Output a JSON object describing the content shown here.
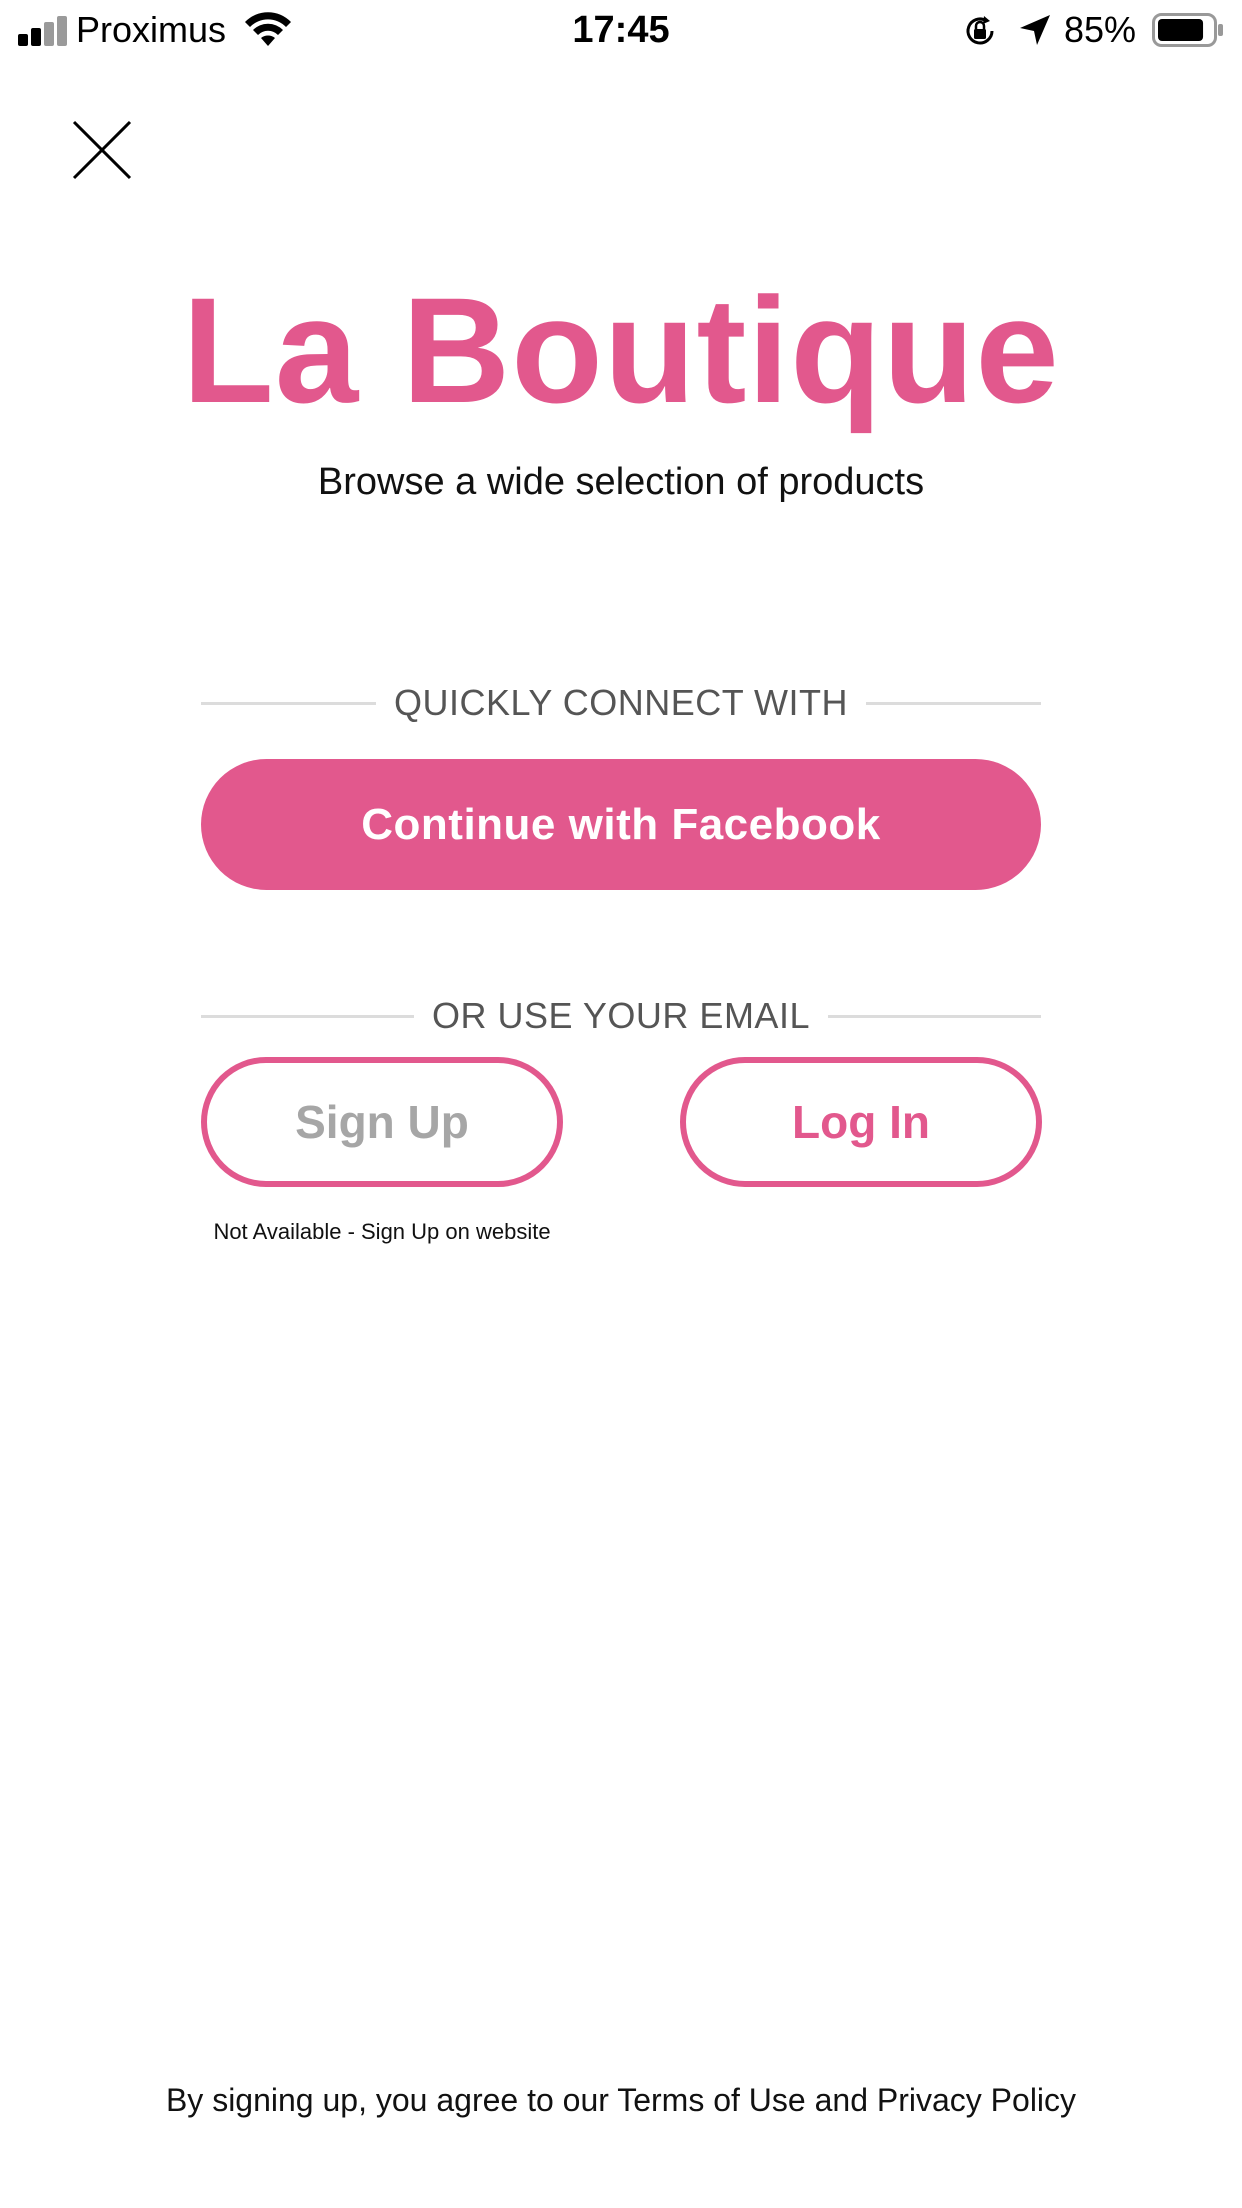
{
  "status_bar": {
    "carrier": "Proximus",
    "time": "17:45",
    "battery_percent": "85%",
    "battery_level": 0.85,
    "signal_bars_active": 2,
    "signal_bars_total": 4
  },
  "close": {
    "icon": "close-icon"
  },
  "brand": {
    "title": "La Boutique",
    "subtitle": "Browse a wide selection of products",
    "accent_color": "#e2588d"
  },
  "social": {
    "heading": "QUICKLY CONNECT WITH",
    "facebook_label": "Continue with Facebook"
  },
  "email": {
    "heading": "OR USE YOUR EMAIL",
    "signup_label": "Sign Up",
    "login_label": "Log In",
    "signup_note": "Not Available - Sign Up on website"
  },
  "footer": {
    "legal_text": "By signing up, you agree to our Terms of Use and Privacy Policy"
  }
}
